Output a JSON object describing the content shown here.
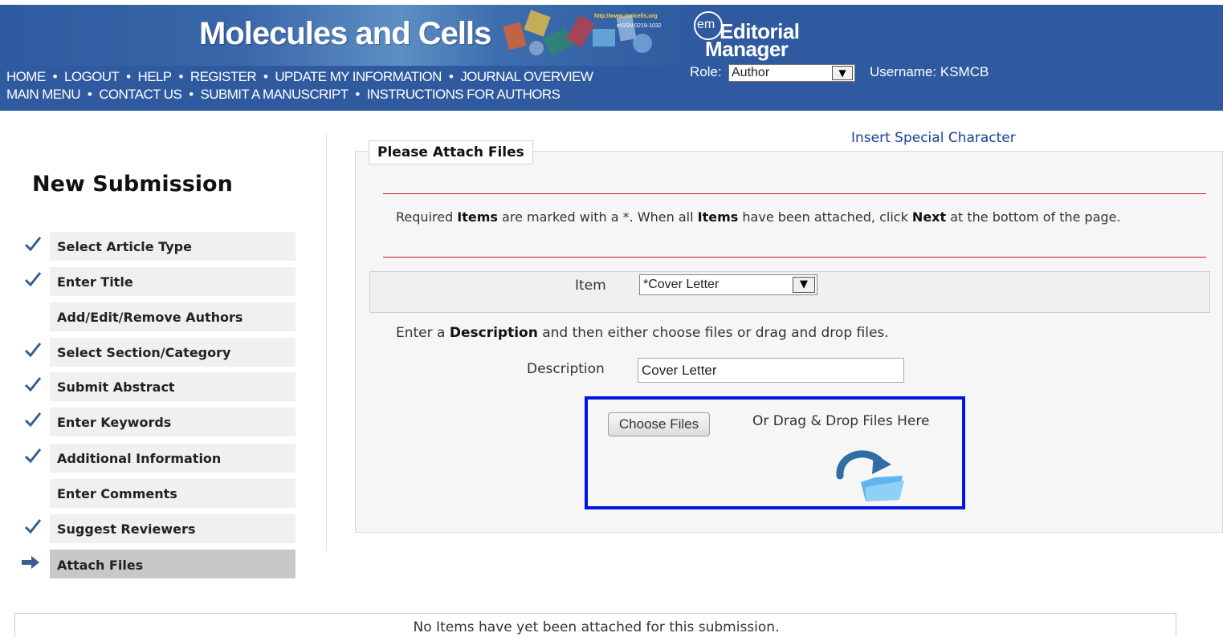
{
  "header": {
    "journal_title": "Molecules and Cells",
    "banner_url": "http://www.molcells.org",
    "banner_issn": "eISSN 0219-1032",
    "logo_mark": "em",
    "logo_line1": "Editorial",
    "logo_line2": "Manager",
    "nav_row1": [
      "HOME",
      "LOGOUT",
      "HELP",
      "REGISTER",
      "UPDATE MY INFORMATION",
      "JOURNAL OVERVIEW"
    ],
    "nav_row2": [
      "MAIN MENU",
      "CONTACT US",
      "SUBMIT A MANUSCRIPT",
      "INSTRUCTIONS FOR AUTHORS"
    ],
    "nav_separator": "•",
    "role_label": "Role:",
    "role_value": "Author",
    "username_label": "Username: KSMCB",
    "colors": {
      "header_bg": "#2f5a9f",
      "text": "#ffffff"
    }
  },
  "sidebar": {
    "title": "New Submission",
    "steps": [
      {
        "label": "Select Article Type",
        "status": "complete",
        "icon": "checkmark-icon"
      },
      {
        "label": "Enter Title",
        "status": "complete",
        "icon": "checkmark-icon"
      },
      {
        "label": "Add/Edit/Remove Authors",
        "status": "incomplete",
        "icon": ""
      },
      {
        "label": "Select Section/Category",
        "status": "complete",
        "icon": "checkmark-icon"
      },
      {
        "label": "Submit Abstract",
        "status": "complete",
        "icon": "checkmark-icon"
      },
      {
        "label": "Enter Keywords",
        "status": "complete",
        "icon": "checkmark-icon"
      },
      {
        "label": "Additional Information",
        "status": "complete",
        "icon": "checkmark-icon"
      },
      {
        "label": "Enter Comments",
        "status": "incomplete",
        "icon": ""
      },
      {
        "label": "Suggest Reviewers",
        "status": "complete",
        "icon": "checkmark-icon"
      },
      {
        "label": "Attach Files",
        "status": "current",
        "icon": "arrow-right-icon"
      }
    ]
  },
  "main": {
    "special_char_link": "Insert Special Character",
    "panel_title": "Please Attach Files",
    "instructions": {
      "p1": "Required ",
      "b1": "Items",
      "p2": " are marked with a *. When all ",
      "b2": "Items",
      "p3": " have been attached, click ",
      "b3": "Next",
      "p4": " at the bottom of the page."
    },
    "item_label": "Item",
    "item_value": "*Cover Letter",
    "desc_instructions": {
      "p1": "Enter a ",
      "b1": "Description",
      "p2": " and then either choose files or drag and drop files."
    },
    "description_label": "Description",
    "description_value": "Cover Letter",
    "choose_files_label": "Choose Files",
    "drag_drop_label": "Or Drag & Drop Files Here",
    "drop_icon": "folder-upload-icon",
    "highlight_color": "#0016e0",
    "no_items_text": "No Items have yet been attached for this submission."
  }
}
